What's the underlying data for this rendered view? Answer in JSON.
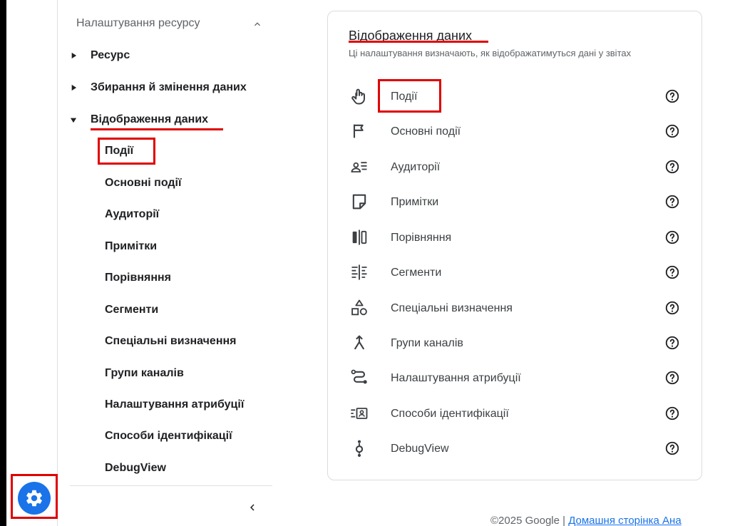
{
  "sidebar": {
    "section_title": "Налаштування ресурсу",
    "tree": [
      {
        "label": "Ресурс"
      },
      {
        "label": "Збирання й змінення даних"
      },
      {
        "label": "Відображення даних"
      }
    ],
    "sub_items": [
      {
        "label": "Події"
      },
      {
        "label": "Основні події"
      },
      {
        "label": "Аудиторії"
      },
      {
        "label": "Примітки"
      },
      {
        "label": "Порівняння"
      },
      {
        "label": "Сегменти"
      },
      {
        "label": "Спеціальні визначення"
      },
      {
        "label": "Групи каналів"
      },
      {
        "label": "Налаштування атрибуції"
      },
      {
        "label": "Способи ідентифікації"
      },
      {
        "label": "DebugView"
      }
    ]
  },
  "panel": {
    "title": "Відображення даних",
    "description": "Ці налаштування визначають, як відображатимуться дані у звітах",
    "rows": [
      {
        "label": "Події",
        "icon": "touch-icon"
      },
      {
        "label": "Основні події",
        "icon": "flag-icon"
      },
      {
        "label": "Аудиторії",
        "icon": "audience-icon"
      },
      {
        "label": "Примітки",
        "icon": "note-icon"
      },
      {
        "label": "Порівняння",
        "icon": "compare-icon"
      },
      {
        "label": "Сегменти",
        "icon": "segment-icon"
      },
      {
        "label": "Спеціальні визначення",
        "icon": "shapes-icon"
      },
      {
        "label": "Групи каналів",
        "icon": "merge-icon"
      },
      {
        "label": "Налаштування атрибуції",
        "icon": "route-icon"
      },
      {
        "label": "Способи ідентифікації",
        "icon": "id-icon"
      },
      {
        "label": "DebugView",
        "icon": "debug-icon"
      }
    ]
  },
  "footer": {
    "copyright": "©2025 Google | ",
    "link": "Домашня сторінка Ана"
  },
  "colors": {
    "accent": "#1a73e8",
    "highlight": "#e00000"
  }
}
